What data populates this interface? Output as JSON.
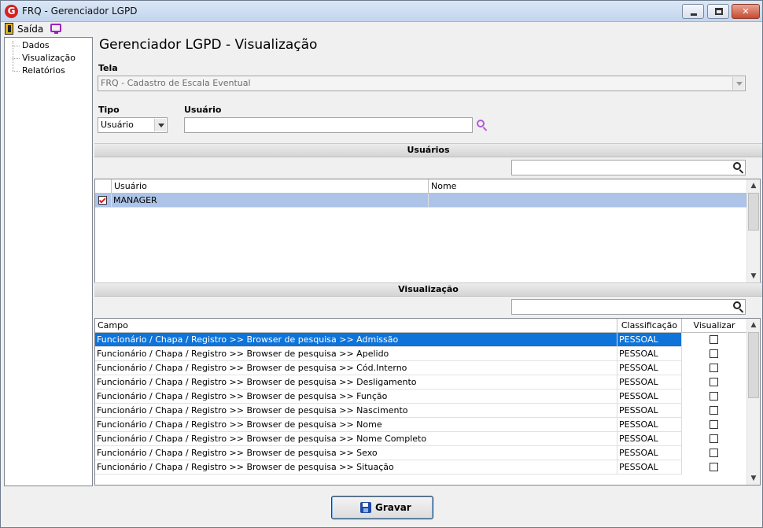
{
  "window": {
    "title": "FRQ - Gerenciador LGPD",
    "app_icon_letter": "G",
    "minimize_glyph": "—",
    "close_glyph": "✕"
  },
  "menu": {
    "exit_label": "Saída"
  },
  "tree": {
    "items": [
      "Dados",
      "Visualização",
      "Relatórios"
    ]
  },
  "main": {
    "title": "Gerenciador LGPD - Visualização",
    "tela_label": "Tela",
    "tela_value": "FRQ - Cadastro de Escala Eventual",
    "tipo_label": "Tipo",
    "tipo_value": "Usuário",
    "usuario_label": "Usuário",
    "usuario_value": ""
  },
  "users_section": {
    "title": "Usuários",
    "search_value": "",
    "columns": [
      "Usuário",
      "Nome"
    ],
    "rows": [
      {
        "checked": true,
        "usuario": "MANAGER",
        "nome": ""
      }
    ]
  },
  "view_section": {
    "title": "Visualização",
    "search_value": "",
    "columns": [
      "Campo",
      "Classificação",
      "Visualizar"
    ],
    "rows": [
      {
        "campo": "Funcionário / Chapa / Registro >> Browser de pesquisa >> Admissão",
        "classificacao": "PESSOAL",
        "visualizar": false
      },
      {
        "campo": "Funcionário / Chapa / Registro >> Browser de pesquisa >> Apelido",
        "classificacao": "PESSOAL",
        "visualizar": false
      },
      {
        "campo": "Funcionário / Chapa / Registro >> Browser de pesquisa >> Cód.Interno",
        "classificacao": "PESSOAL",
        "visualizar": false
      },
      {
        "campo": "Funcionário / Chapa / Registro >> Browser de pesquisa >> Desligamento",
        "classificacao": "PESSOAL",
        "visualizar": false
      },
      {
        "campo": "Funcionário / Chapa / Registro >> Browser de pesquisa >> Função",
        "classificacao": "PESSOAL",
        "visualizar": false
      },
      {
        "campo": "Funcionário / Chapa / Registro >> Browser de pesquisa >> Nascimento",
        "classificacao": "PESSOAL",
        "visualizar": false
      },
      {
        "campo": "Funcionário / Chapa / Registro >> Browser de pesquisa >> Nome",
        "classificacao": "PESSOAL",
        "visualizar": false
      },
      {
        "campo": "Funcionário / Chapa / Registro >> Browser de pesquisa >> Nome Completo",
        "classificacao": "PESSOAL",
        "visualizar": false
      },
      {
        "campo": "Funcionário / Chapa / Registro >> Browser de pesquisa >> Sexo",
        "classificacao": "PESSOAL",
        "visualizar": false
      },
      {
        "campo": "Funcionário / Chapa / Registro >> Browser de pesquisa >> Situação",
        "classificacao": "PESSOAL",
        "visualizar": false
      }
    ]
  },
  "footer": {
    "save_label": "Gravar"
  },
  "colors": {
    "selected_row": "#0f74d9",
    "selected_user_row": "#adc4e8",
    "accent_purple": "#b05bd8"
  }
}
